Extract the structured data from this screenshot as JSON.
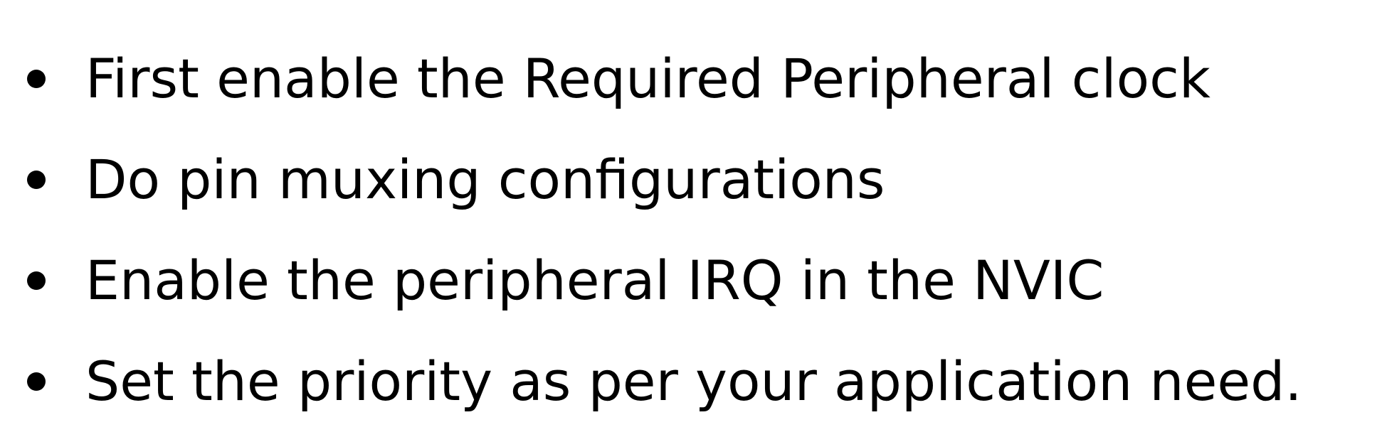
{
  "slide": {
    "bullets": [
      "First enable the Required Peripheral clock",
      "Do pin muxing configurations",
      "Enable the peripheral IRQ in the NVIC",
      "Set the priority as per your application need."
    ]
  }
}
